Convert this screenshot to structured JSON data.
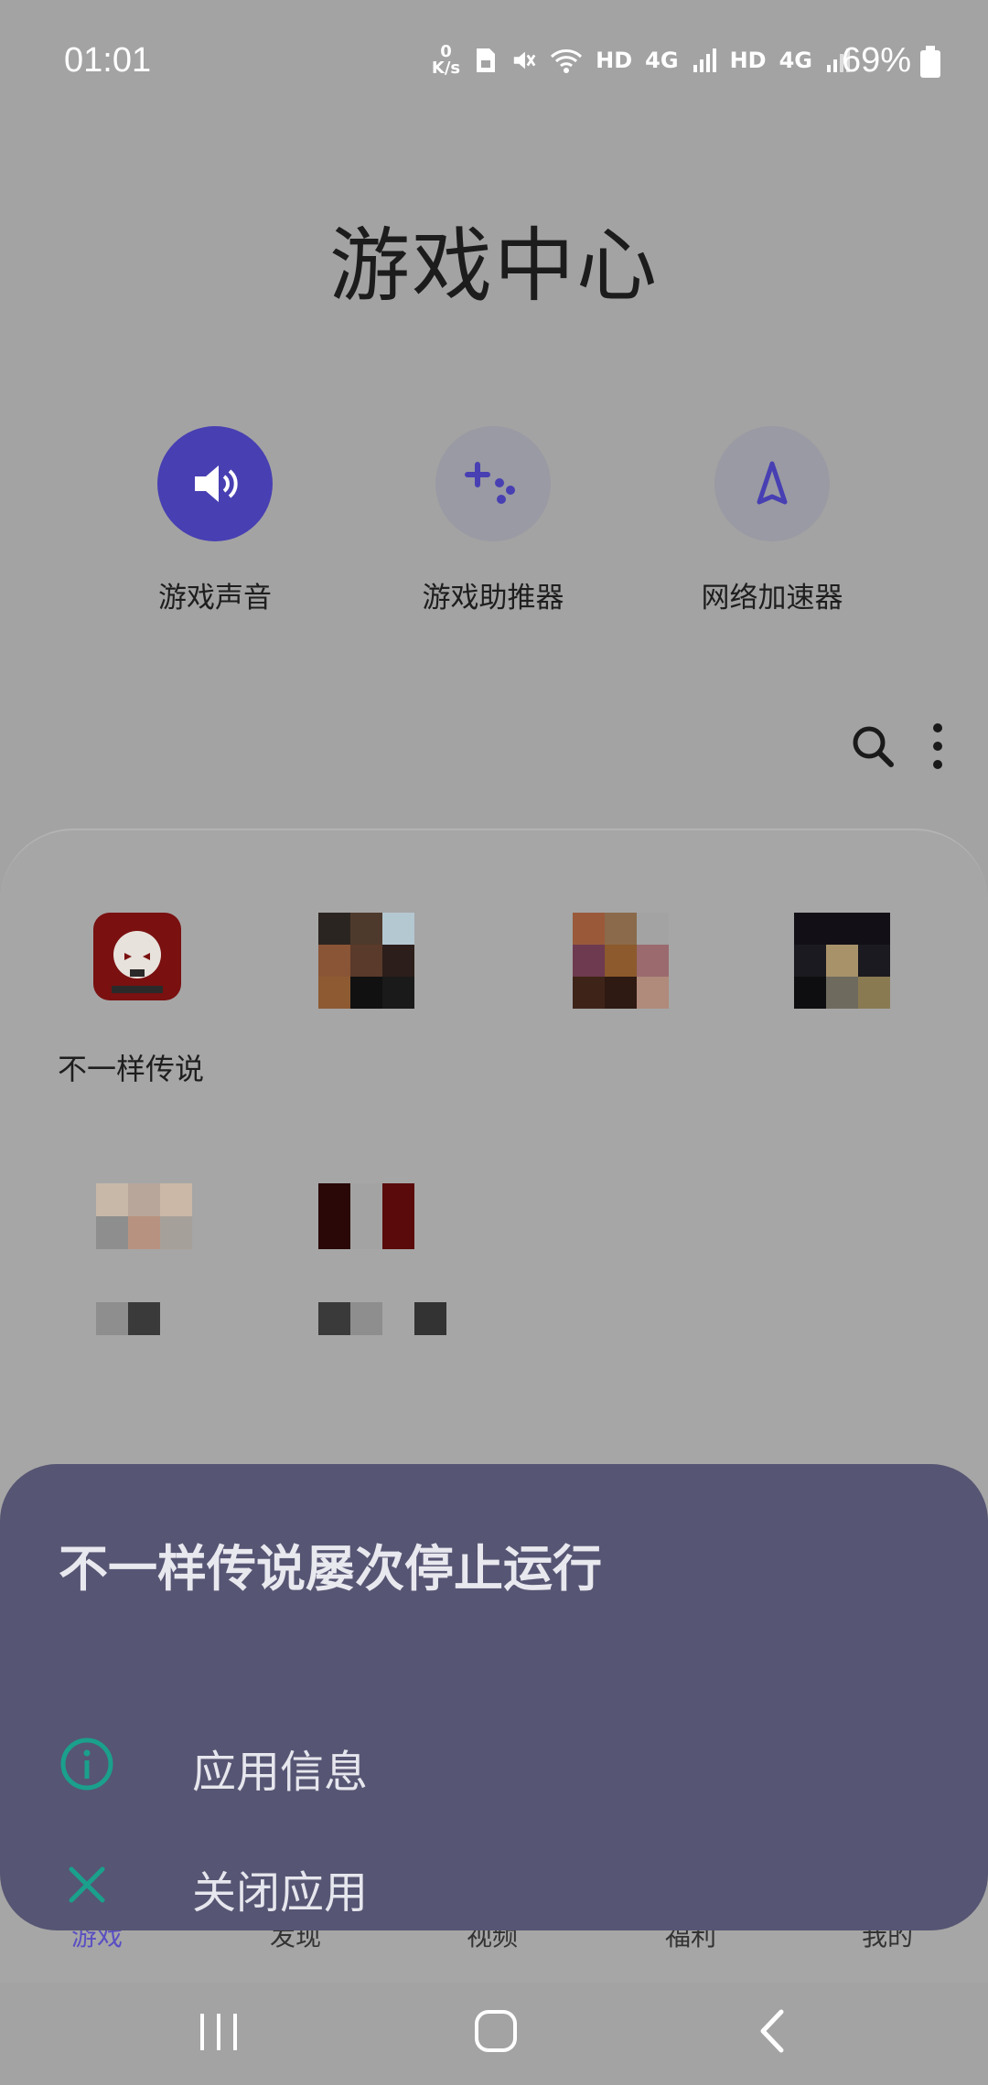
{
  "status_bar": {
    "time": "01:01",
    "net_speed_value": "0",
    "net_speed_unit": "K/s",
    "hd1": "HD",
    "g1": "4G",
    "hd2": "HD",
    "g2": "4G",
    "battery": "69%"
  },
  "page_title": "游戏中心",
  "quick_actions": [
    {
      "label": "游戏声音",
      "icon": "speaker-icon"
    },
    {
      "label": "游戏助推器",
      "icon": "gamepad-plus-icon"
    },
    {
      "label": "网络加速器",
      "icon": "rocket-icon"
    }
  ],
  "games": [
    {
      "name": "不一样传说"
    },
    {
      "name": ""
    },
    {
      "name": ""
    },
    {
      "name": ""
    },
    {
      "name": ""
    },
    {
      "name": ""
    }
  ],
  "dialog": {
    "title": "不一样传说屡次停止运行",
    "options": [
      {
        "label": "应用信息",
        "icon": "info-icon"
      },
      {
        "label": "关闭应用",
        "icon": "close-icon"
      }
    ]
  },
  "bottom_nav": [
    "游戏",
    "发现",
    "视频",
    "福利",
    "我的"
  ],
  "colors": {
    "accent": "#483fb3",
    "dialog_bg": "#565573",
    "dialog_icon": "#1aa08c",
    "scrim": "#a3a3a3"
  }
}
